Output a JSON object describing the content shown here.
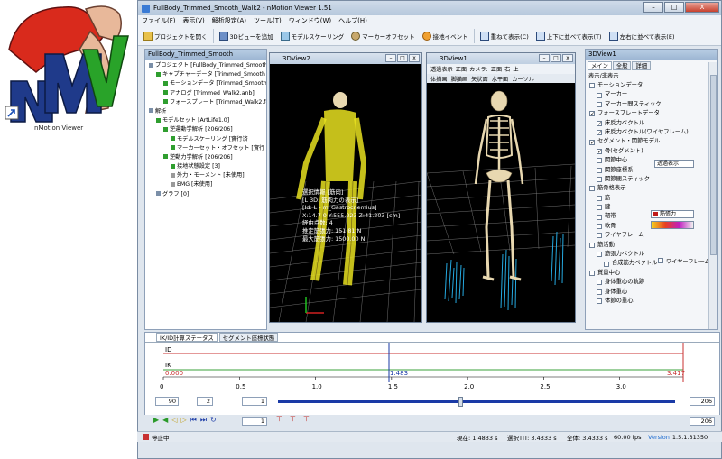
{
  "desktop": {
    "icon_label": "nMotion Viewer"
  },
  "window": {
    "title": "FullBody_Trimmed_Smooth_Walk2 - nMotion Viewer 1.51",
    "minimize": "–",
    "maximize": "□",
    "close": "X"
  },
  "menu": [
    "ファイル(F)",
    "表示(V)",
    "解析設定(A)",
    "ツール(T)",
    "ウィンドウ(W)",
    "ヘルプ(H)"
  ],
  "toolbar": [
    "プロジェクトを開く",
    "3Dビューを追加",
    "モデルスケーリング",
    "マーカーオフセット",
    "接地イベント",
    "重ねて表示(C)",
    "上下に並べて表示(T)",
    "左右に並べて表示(E)"
  ],
  "tree": {
    "title": "FullBody_Trimmed_Smooth",
    "items": [
      {
        "label": "プロジェクト [FullBody_Trimmed_Smooth",
        "indent": 0,
        "color": "#7b8fa8"
      },
      {
        "label": "キャプチャーデータ [Trimmed_Smooth",
        "indent": 1,
        "color": "#2f9e2f"
      },
      {
        "label": "モーションデータ [Trimmed_Smooth_W",
        "indent": 2,
        "color": "#2f9e2f"
      },
      {
        "label": "アナログ [Trimmed_Walk2.anb]",
        "indent": 2,
        "color": "#2f9e2f"
      },
      {
        "label": "フォースプレート [Trimmed_Walk2.forc",
        "indent": 2,
        "color": "#2f9e2f"
      },
      {
        "label": "解析",
        "indent": 0,
        "color": "#7b8fa8"
      },
      {
        "label": "モデルセット [ArtLife1.0]",
        "indent": 1,
        "color": "#2f9e2f"
      },
      {
        "label": "逆運動学解析 [206/206]",
        "indent": 2,
        "color": "#2f9e2f"
      },
      {
        "label": "モデルスケーリング [實行済",
        "indent": 3,
        "color": "#2f9e2f"
      },
      {
        "label": "マーカーセット・オフセット [實行",
        "indent": 3,
        "color": "#2f9e2f"
      },
      {
        "label": "逆動力学解析 [206/206]",
        "indent": 2,
        "color": "#2f9e2f"
      },
      {
        "label": "接地状態設定 [3]",
        "indent": 3,
        "color": "#2f9e2f"
      },
      {
        "label": "外力・モーメント [未使用]",
        "indent": 3,
        "color": "#9a9a9a"
      },
      {
        "label": "EMG [未使用]",
        "indent": 3,
        "color": "#9a9a9a"
      },
      {
        "label": "グラフ [0]",
        "indent": 1,
        "color": "#7b8fa8"
      }
    ]
  },
  "view2": {
    "title": "3DView2",
    "info": [
      "選択情報 [筋肉]",
      "[L 3D: 筋肉力の表示]",
      "[Id: L - m_Gastrocnemius]",
      "X:14.7 0 Y:555.023 Z:41.203 [cm]",
      "経由点数: 4",
      "推定筋張力: 151.81 N",
      "最大筋張力: 1500.00 N"
    ]
  },
  "view1": {
    "title": "3DView1",
    "toolbar": [
      "透過表示",
      "正面",
      "カメラ:",
      "正面",
      "右",
      "上"
    ],
    "toolbar2": [
      "体描画",
      "脚描画",
      "矢状面",
      "水平面",
      "カーソル"
    ]
  },
  "props": {
    "title": "3DView1",
    "tabs": [
      "メイン",
      "全般",
      "詳細"
    ],
    "header": "表示/非表示",
    "rows": [
      {
        "label": "モーションデータ",
        "indent": 0,
        "checked": false
      },
      {
        "label": "マーカー",
        "indent": 1,
        "checked": false
      },
      {
        "label": "マーカー間スティック",
        "indent": 1,
        "checked": false
      },
      {
        "label": "フォースプレートデータ",
        "indent": 0,
        "checked": true
      },
      {
        "label": "床反力ベクトル",
        "indent": 1,
        "checked": true
      },
      {
        "label": "床反力ベクトル(ワイヤフレーム)",
        "indent": 1,
        "checked": true
      },
      {
        "label": "セグメント・関節モデル",
        "indent": 0,
        "checked": true
      },
      {
        "label": "骨(セグメント)",
        "indent": 1,
        "checked": true
      },
      {
        "label": "関節中心",
        "indent": 1,
        "checked": false
      },
      {
        "label": "関節座標系",
        "indent": 1,
        "checked": false
      },
      {
        "label": "関節間スティック",
        "indent": 1,
        "checked": false
      },
      {
        "label": "筋骨格表示",
        "indent": 0,
        "checked": false
      },
      {
        "label": "筋",
        "indent": 1,
        "checked": false
      },
      {
        "label": "腱",
        "indent": 1,
        "checked": false
      },
      {
        "label": "靭帯",
        "indent": 1,
        "checked": false
      },
      {
        "label": "軟骨",
        "indent": 1,
        "checked": false
      },
      {
        "label": "ワイヤフレーム",
        "indent": 1,
        "checked": false
      },
      {
        "label": "筋活動",
        "indent": 0,
        "checked": false
      },
      {
        "label": "筋張力ベクトル",
        "indent": 1,
        "checked": false
      },
      {
        "label": "合成筋力ベクトル",
        "indent": 2,
        "checked": false
      },
      {
        "label": "質量中心",
        "indent": 0,
        "checked": false
      },
      {
        "label": "身体重心の軌跡",
        "indent": 1,
        "checked": false
      },
      {
        "label": "身体重心",
        "indent": 1,
        "checked": false
      },
      {
        "label": "体節の重心",
        "indent": 1,
        "checked": false
      }
    ],
    "segment_select": "透過表示",
    "muscle_select": "筋張力",
    "wireframe_label": "ワイヤーフレーム"
  },
  "bottom": {
    "tabs": [
      "IK/ID計算ステータス",
      "セグメント座標状態"
    ],
    "lanes": [
      "ID",
      "IK"
    ],
    "start_value": "0.000",
    "cursor_value": "1.483",
    "end_value": "3.417",
    "ticks": [
      "0",
      "0.5",
      "1.0",
      "1.5",
      "2.0",
      "2.5",
      "3.0"
    ],
    "colors": {
      "id_line": "#c83232",
      "ik_line": "#3aa23a",
      "cursor": "#1a3aa6"
    }
  },
  "controls": {
    "fps": "90",
    "step": "2",
    "start_frame": "1",
    "current_frame": "1",
    "end_frame": "206",
    "end_frame2": "206",
    "progress": 0.46
  },
  "status": {
    "state": "停止中",
    "current": "現在: 1.4833 s",
    "selection": "選択TIT: 3.4333 s",
    "total": "全体: 3.4333 s",
    "fps": "60.00 fps",
    "version_label": "Version",
    "version": "1.5.1.31350"
  }
}
